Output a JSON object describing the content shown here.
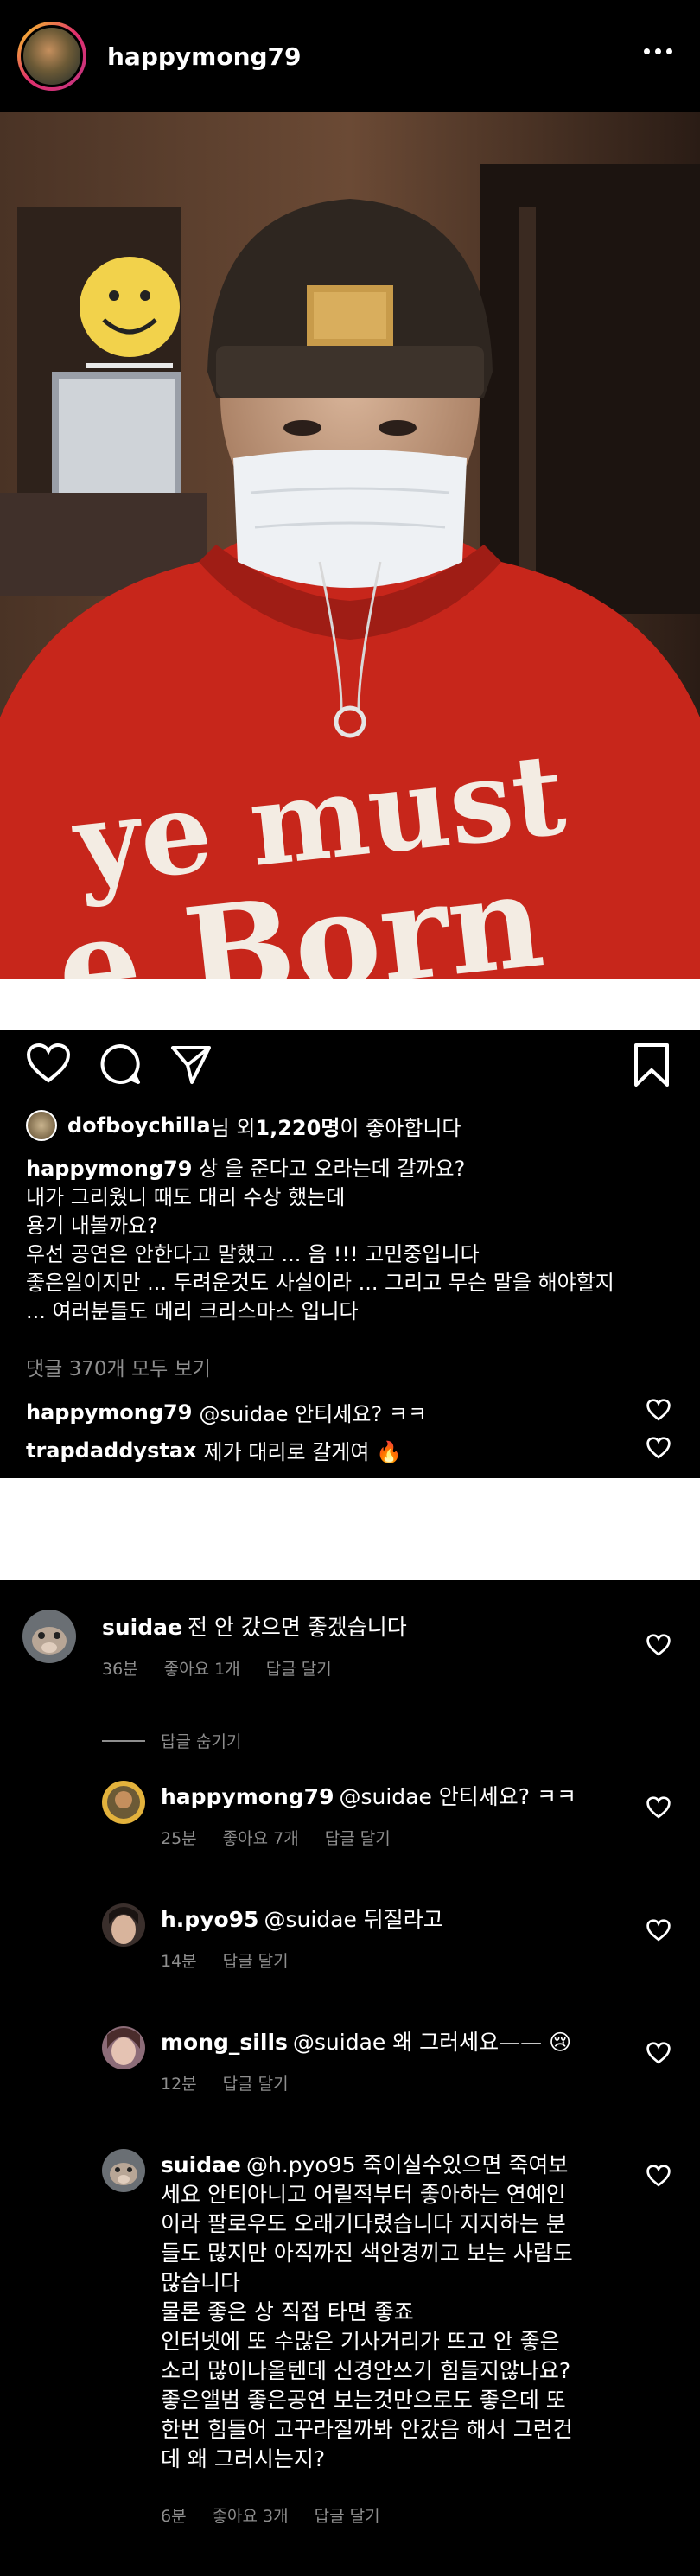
{
  "post": {
    "username": "happymong79",
    "photo_text": {
      "line1": "ye must",
      "line2": "e Born"
    }
  },
  "actions": {
    "likes": {
      "user": "dofboychilla",
      "mid": "님 외 ",
      "count": "1,220명",
      "suffix": "이 좋아합니다"
    },
    "caption": {
      "user": "happymong79",
      "lines": "상 을 준다고 오라는데 갈까요?\n내가 그리웠니 때도 대리 수상 했는데\n용기 내볼까요?\n우선 공연은 안한다고 말했고 ... 음 !!! 고민중입니다\n좋은일이지만 ... 두려운것도 사실이라 ... 그리고 무슨 말을 해야할지\n... 여러분들도 메리 크리스마스 입니다"
    },
    "view_all": "댓글 370개 모두 보기",
    "preview_comments": [
      {
        "user": "happymong79",
        "text": "@suidae 안티세요? ㅋㅋ"
      },
      {
        "user": "trapdaddystax",
        "text": "제가 대리로 갈게여 🔥"
      }
    ]
  },
  "comments": {
    "hide_replies": "답글 숨기기",
    "items": [
      {
        "user": "suidae",
        "text": "전 안 갔으면 좋겠습니다",
        "time": "36분",
        "likes": "좋아요 1개",
        "reply": "답글 달기"
      },
      {
        "user": "happymong79",
        "text": "@suidae 안티세요? ㅋㅋ",
        "time": "25분",
        "likes": "좋아요 7개",
        "reply": "답글 달기"
      },
      {
        "user": "h.pyo95",
        "text": "@suidae 뒤질라고",
        "time": "14분",
        "reply": "답글 달기"
      },
      {
        "user": "mong_sills",
        "text": "@suidae 왜 그러세요—— 😢",
        "time": "12분",
        "reply": "답글 달기"
      },
      {
        "user": "suidae",
        "text": "@h.pyo95 죽이실수있으면 죽여보\n세요 안티아니고 어릴적부터 좋아하는 연예인\n이라 팔로우도 오래기다렸습니다 지지하는 분\n들도 많지만 아직까진 색안경끼고 보는 사람도\n많습니다\n물론 좋은 상 직접 타면 좋죠\n인터넷에 또 수많은 기사거리가 뜨고 안 좋은\n소리 많이나올텐데 신경안쓰기 힘들지않나요?\n좋은앨범 좋은공연 보는것만으로도 좋은데 또\n한번 힘들어 고꾸라질까봐 안갔음 해서 그런건\n데 왜 그러시는지?",
        "time": "6분",
        "likes": "좋아요 3개",
        "reply": "답글 달기"
      }
    ]
  },
  "icons": [
    "more-icon",
    "heart-icon",
    "comment-icon",
    "share-icon",
    "bookmark-icon",
    "fire-emoji",
    "crying-emoji"
  ]
}
